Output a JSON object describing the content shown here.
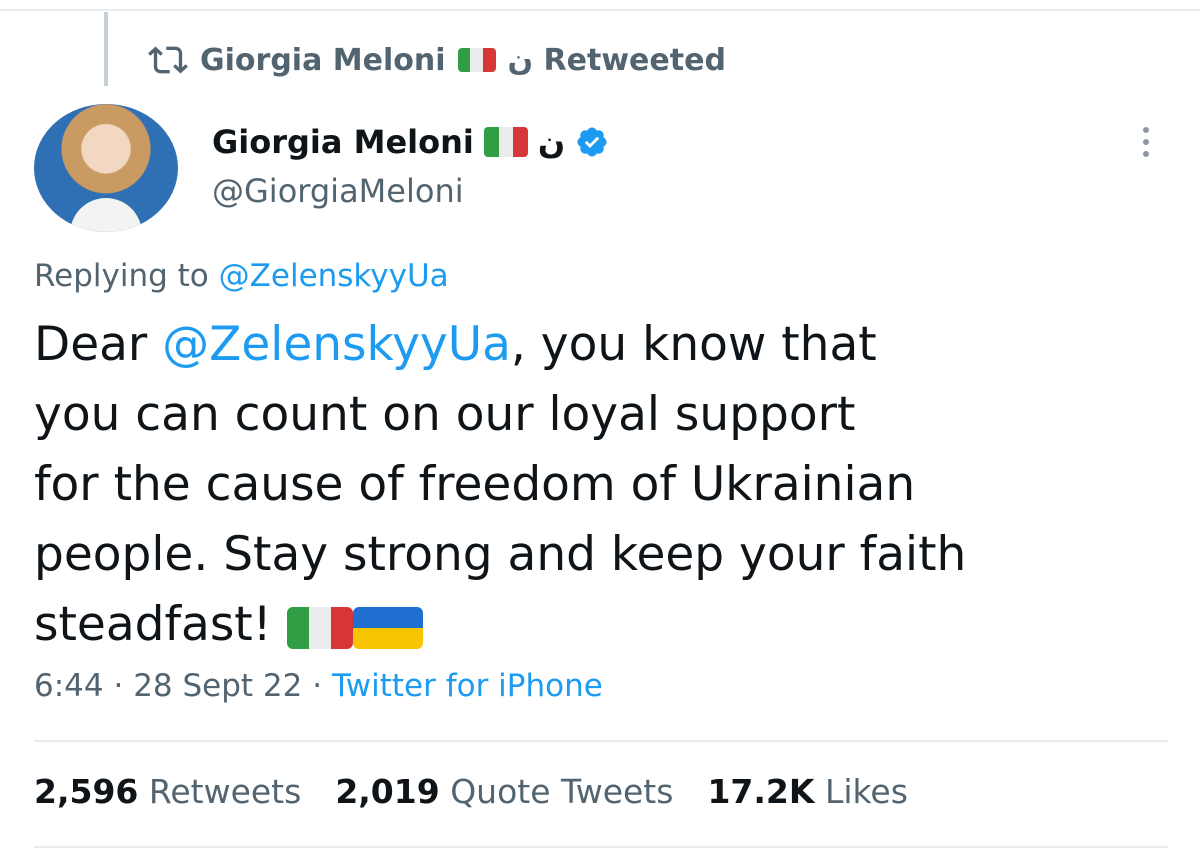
{
  "retweet": {
    "label": "Giorgia Meloni",
    "suffix": "ن Retweeted"
  },
  "author": {
    "name": "Giorgia Meloni",
    "suffix": "ن",
    "handle": "@GiorgiaMeloni"
  },
  "reply": {
    "prefix": "Replying to",
    "to": "@ZelenskyyUa"
  },
  "tweet": {
    "l1_pre": "Dear ",
    "l1_mention": "@ZelenskyyUa",
    "l1_post": ", you know that",
    "l2": "you can count on our loyal support",
    "l3": "for the cause of freedom of Ukrainian",
    "l4": "people. Stay strong and keep your faith",
    "l5": "steadfast! "
  },
  "meta": {
    "time": "6:44",
    "sep1": " · ",
    "date": "28 Sept 22",
    "sep2": " · ",
    "client": "Twitter for iPhone"
  },
  "stats": {
    "retweets": "2,596",
    "retweets_label": "Retweets",
    "quotes": "2,019",
    "quotes_label": "Quote Tweets",
    "likes": "17.2K",
    "likes_label": "Likes"
  },
  "colors": {
    "link": "#1d9bf0",
    "muted": "#536471",
    "text": "#0f1419",
    "verified": "#1d9bf0"
  },
  "icons": [
    "retweet-icon",
    "verified-icon",
    "more-icon",
    "italy-flag-icon",
    "ukraine-flag-icon"
  ]
}
